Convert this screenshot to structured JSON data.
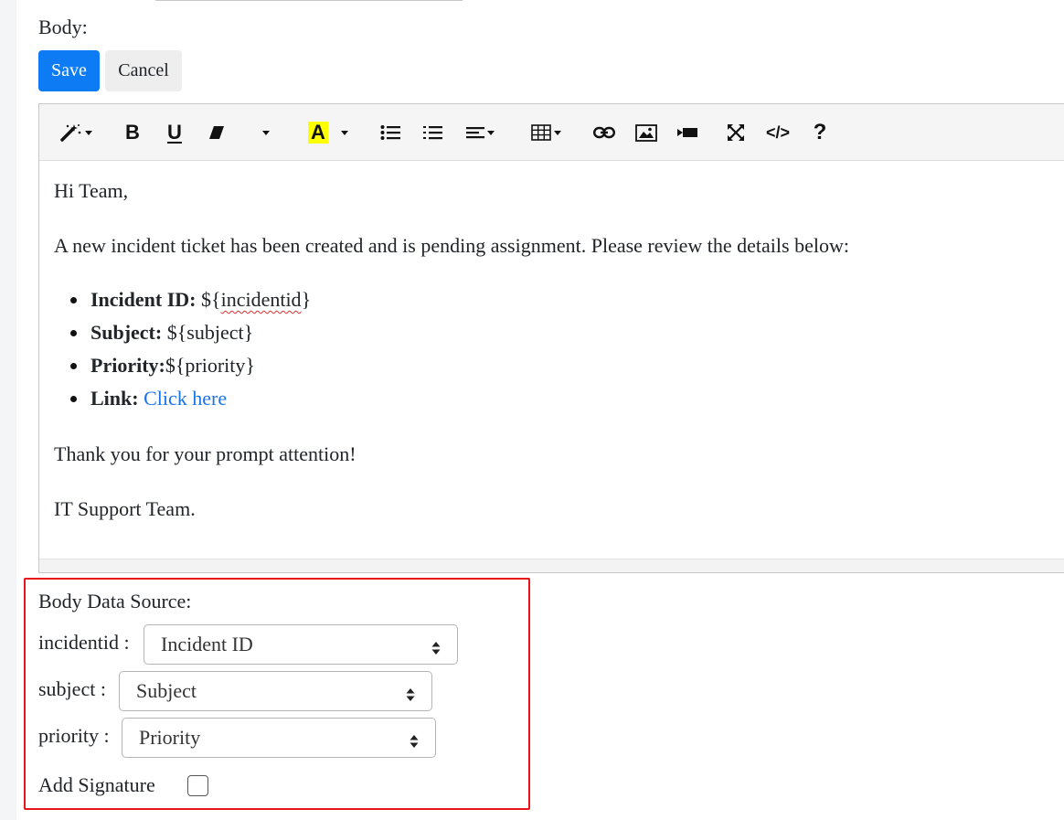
{
  "form": {
    "body_label": "Body:",
    "save_label": "Save",
    "cancel_label": "Cancel"
  },
  "toolbar": {
    "buttons": [
      {
        "name": "magic-style-icon",
        "caret": true
      },
      {
        "name": "bold-button",
        "text": "B"
      },
      {
        "name": "underline-button",
        "text": "U"
      },
      {
        "name": "eraser-icon"
      },
      {
        "name": "font-dropdown",
        "caret": true
      },
      {
        "name": "text-color-button",
        "text": "A",
        "caret": true,
        "highlight": "#ffff00"
      },
      {
        "name": "unordered-list-icon"
      },
      {
        "name": "ordered-list-icon"
      },
      {
        "name": "align-icon",
        "caret": true
      },
      {
        "name": "table-icon",
        "caret": true
      },
      {
        "name": "link-icon"
      },
      {
        "name": "picture-icon"
      },
      {
        "name": "video-icon"
      },
      {
        "name": "fullscreen-icon"
      },
      {
        "name": "code-view-icon",
        "text": "</>"
      },
      {
        "name": "help-icon",
        "text": "?"
      }
    ]
  },
  "email": {
    "greeting": "Hi Team,",
    "intro": "A new incident ticket has been created and is pending assignment. Please review the details below:",
    "items": [
      {
        "label": "Incident ID:",
        "value": " ${incidentid}"
      },
      {
        "label": "Subject:",
        "value": " ${subject}"
      },
      {
        "label": "Priority:",
        "value": "${priority}"
      },
      {
        "label": "Link:",
        "value": " ",
        "link_text": "Click here"
      }
    ],
    "thanks": "Thank you for your prompt attention!",
    "signoff": "IT Support Team."
  },
  "data_source": {
    "title": "Body Data Source:",
    "fields": [
      {
        "label": "incidentid :",
        "selected": "Incident ID"
      },
      {
        "label": "subject :",
        "selected": "Subject"
      },
      {
        "label": "priority :",
        "selected": "Priority"
      }
    ],
    "signature_label": "Add Signature",
    "signature_checked": false
  },
  "colors": {
    "primary": "#0d7bf3",
    "highlight_box": "#e8141c",
    "link": "#1a73e8",
    "text_highlight": "#ffff00"
  }
}
